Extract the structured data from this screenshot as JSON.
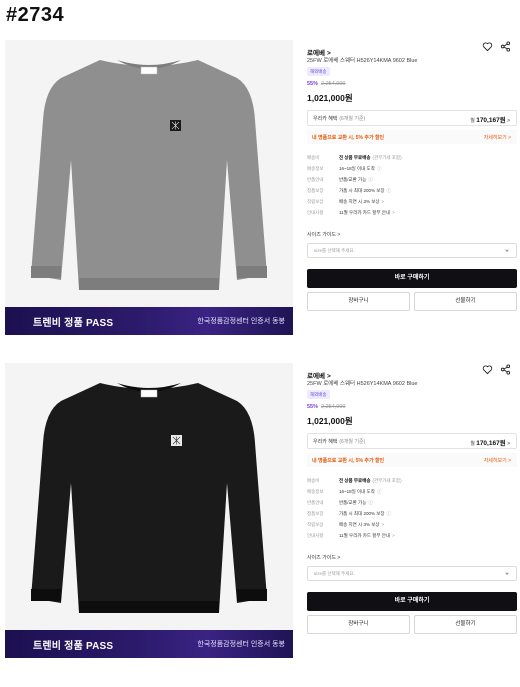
{
  "page_tag": "#2734",
  "listings": [
    {
      "image_alt": "gray-sweater",
      "sweater_color": "#8f8f8f",
      "sweater_shadow": "#7d7d7d",
      "banner": {
        "title": "트렌비 정품 PASS",
        "subtitle": "한국정품감정센터 인증서 동봉"
      },
      "brand": "로에베",
      "brand_chevron": ">",
      "product_name": "25FW 로에베 스웨터 H526Y14KMA 9602 Blue",
      "badge": "해외배송",
      "discount": "55%",
      "original_price": "2,254,000",
      "final_price": "1,021,000원",
      "benefit": {
        "label": "우리카 혜택",
        "note": "(6개월 기준)",
        "prefix": "월",
        "value": "170,167원",
        "chevron": ">"
      },
      "promo": {
        "text": "내 명품으로 교환 시, 5% 추가 할인",
        "link": "자세히보기 >"
      },
      "info": [
        {
          "label": "배송비",
          "value": "전 상품 무료배송",
          "sub": "(관부가세 포함)",
          "bold": true
        },
        {
          "label": "배송정보",
          "value": "16~18일 이내 도착",
          "chevron": "ⓘ"
        },
        {
          "label": "반품안내",
          "value": "반품/교환 가능",
          "chevron": "ⓘ"
        },
        {
          "label": "정품보장",
          "value": "가품 시 최대 200% 보장",
          "chevron": "ⓘ"
        },
        {
          "label": "적립보상",
          "value": "배송 지연 시 3% 보상",
          "chevron": ">"
        },
        {
          "label": "안내사항",
          "value": "11월 우리카 카드 할부 안내",
          "chevron": ">"
        }
      ],
      "size_guide": "사이즈 가이드 >",
      "size_placeholder": "size를 선택해 주세요.",
      "buy_now": "바로 구매하기",
      "cart": "장바구니",
      "gift": "선물하기"
    },
    {
      "image_alt": "black-sweater",
      "sweater_color": "#1a1a1a",
      "sweater_shadow": "#0d0d0d",
      "banner": {
        "title": "트렌비 정품 PASS",
        "subtitle": "한국정품감정센터 인증서 동봉"
      },
      "brand": "로에베",
      "brand_chevron": ">",
      "product_name": "25FW 로에베 스웨터 H526Y14KMA 9602 Blue",
      "badge": "해외배송",
      "discount": "55%",
      "original_price": "2,254,000",
      "final_price": "1,021,000원",
      "benefit": {
        "label": "우리카 혜택",
        "note": "(6개월 기준)",
        "prefix": "월",
        "value": "170,167원",
        "chevron": ">"
      },
      "promo": {
        "text": "내 명품으로 교환 시, 5% 추가 할인",
        "link": "자세히보기 >"
      },
      "info": [
        {
          "label": "배송비",
          "value": "전 상품 무료배송",
          "sub": "(관부가세 포함)",
          "bold": true
        },
        {
          "label": "배송정보",
          "value": "16~18일 이내 도착",
          "chevron": "ⓘ"
        },
        {
          "label": "반품안내",
          "value": "반품/교환 가능",
          "chevron": "ⓘ"
        },
        {
          "label": "정품보장",
          "value": "가품 시 최대 200% 보장",
          "chevron": "ⓘ"
        },
        {
          "label": "적립보상",
          "value": "배송 지연 시 3% 보상",
          "chevron": ">"
        },
        {
          "label": "안내사항",
          "value": "11월 우리카 카드 할부 안내",
          "chevron": ">"
        }
      ],
      "size_guide": "사이즈 가이드 >",
      "size_placeholder": "size를 선택해 주세요.",
      "buy_now": "바로 구매하기",
      "cart": "장바구니",
      "gift": "선물하기"
    }
  ]
}
